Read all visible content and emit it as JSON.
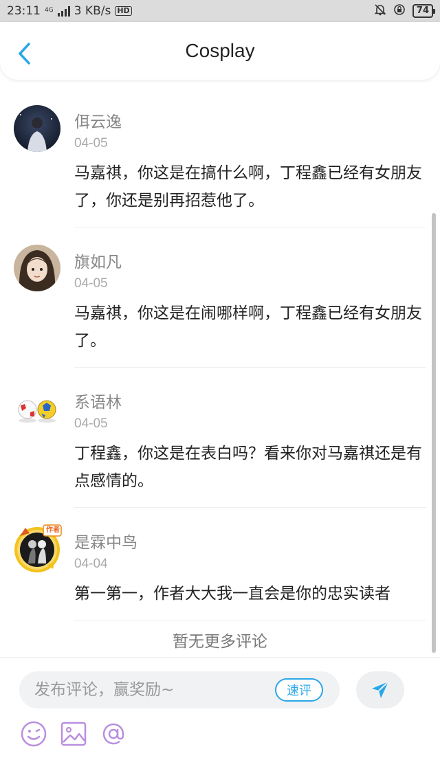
{
  "status_bar": {
    "time": "23:11",
    "network": "4G",
    "speed": "3 KB/s",
    "hd": "HD",
    "battery": "74"
  },
  "header": {
    "title": "Cosplay"
  },
  "comments": [
    {
      "username": "佴云逸",
      "date": "04-05",
      "text": "马嘉祺，你这是在搞什么啊，丁程鑫已经有女朋友了，你还是别再招惹他了。"
    },
    {
      "username": "旗如凡",
      "date": "04-05",
      "text": "马嘉祺，你这是在闹哪样啊，丁程鑫已经有女朋友了。"
    },
    {
      "username": "系语林",
      "date": "04-05",
      "text": "丁程鑫，你这是在表白吗？看来你对马嘉祺还是有点感情的。"
    },
    {
      "username": "是霖中鸟",
      "date": "04-04",
      "text": "第一第一，作者大大我一直会是你的忠实读者",
      "badge": "作者"
    }
  ],
  "footer_text": "暂无更多评论",
  "input": {
    "placeholder": "发布评论，赢奖励~",
    "quick_label": "速评"
  },
  "colors": {
    "accent": "#2aa7e8",
    "tool_icon": "#b98ee0"
  }
}
